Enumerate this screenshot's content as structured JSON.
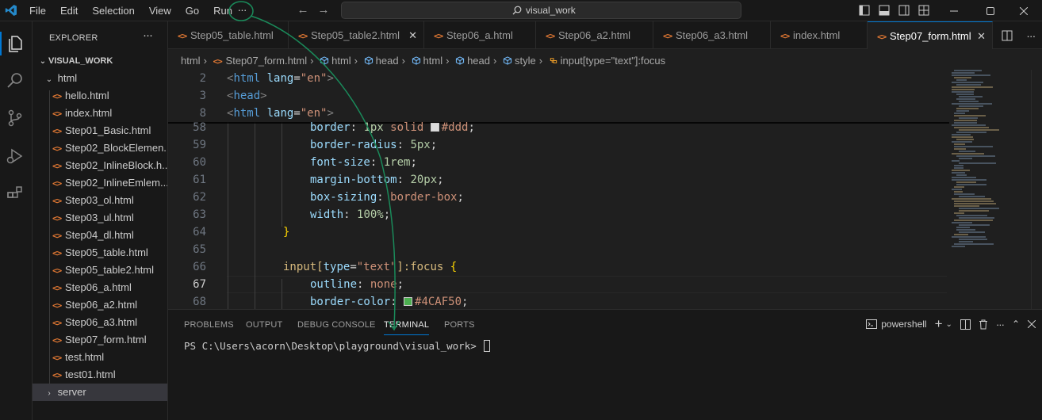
{
  "menu": [
    "File",
    "Edit",
    "Selection",
    "View",
    "Go",
    "Run"
  ],
  "more_label": "···",
  "search": {
    "text": "visual_work"
  },
  "sidebar": {
    "title": "EXPLORER",
    "root": "VISUAL_WORK",
    "folder_html": "html",
    "files": [
      "hello.html",
      "index.html",
      "Step01_Basic.html",
      "Step02_BlockElemen...",
      "Step02_InlineBlock.h...",
      "Step02_InlineEmlem...",
      "Step03_ol.html",
      "Step03_ul.html",
      "Step04_dl.html",
      "Step05_table.html",
      "Step05_table2.html",
      "Step06_a.html",
      "Step06_a2.html",
      "Step06_a3.html",
      "Step07_form.html",
      "test.html",
      "test01.html"
    ],
    "folder_server": "server"
  },
  "tabs": [
    "Step05_table.html",
    "Step05_table2.html",
    "Step06_a.html",
    "Step06_a2.html",
    "Step06_a3.html",
    "index.html",
    "Step07_form.html"
  ],
  "breadcrumbs": [
    "html",
    "Step07_form.html",
    "html",
    "head",
    "html",
    "head",
    "style",
    "input[type=\"text\"]:focus"
  ],
  "code": {
    "sticky_numbers": [
      "2",
      "3",
      "8"
    ],
    "numbers": [
      "58",
      "59",
      "60",
      "61",
      "62",
      "63",
      "64",
      "65",
      "66",
      "67",
      "68"
    ],
    "sticky": {
      "l2_open": "<",
      "l2_tag": "html",
      "l2_attr": "lang",
      "l2_eq": "=",
      "l2_val": "\"en\"",
      "l2_close": ">",
      "l3_open": "<",
      "l3_tag": "head",
      "l3_close": ">",
      "l8_open": "<",
      "l8_tag": "html",
      "l8_attr": "lang",
      "l8_eq": "=",
      "l8_val": "\"en\"",
      "l8_close": ">"
    },
    "l58": {
      "prop": "border",
      "colon": ": ",
      "num": "1px",
      "val": " solid ",
      "color": "#ddd",
      "end": ";"
    },
    "l59": {
      "prop": "border-radius",
      "colon": ": ",
      "num": "5px",
      "end": ";"
    },
    "l60": {
      "prop": "font-size",
      "colon": ": ",
      "num": "1rem",
      "end": ";"
    },
    "l61": {
      "prop": "margin-bottom",
      "colon": ": ",
      "num": "20px",
      "end": ";"
    },
    "l62": {
      "prop": "box-sizing",
      "colon": ": ",
      "val": "border-box",
      "end": ";"
    },
    "l63": {
      "prop": "width",
      "colon": ": ",
      "num": "100%",
      "end": ";"
    },
    "l64": {
      "brace": "}"
    },
    "l66": {
      "sel": "input",
      "br_open": "[",
      "attr": "type",
      "eq": "=",
      "str": "\"text\"",
      "br_close": "]",
      "pseudo": ":focus",
      "space": " ",
      "brace": "{"
    },
    "l67": {
      "prop": "outline",
      "colon": ": ",
      "val": "none",
      "end": ";"
    },
    "l68": {
      "prop": "border-color",
      "colon": ": ",
      "color": "#4CAF50",
      "end": ";"
    }
  },
  "panel": {
    "tabs": [
      "PROBLEMS",
      "OUTPUT",
      "DEBUG CONSOLE",
      "TERMINAL",
      "PORTS"
    ],
    "shell": "powershell",
    "prompt": "PS C:\\Users\\acorn\\Desktop\\playground\\visual_work> "
  },
  "colors": {
    "accent": "#0078d4",
    "swatch_ddd": "#dddddd",
    "swatch_green": "#4CAF50",
    "annotation": "#1a8a5a"
  }
}
